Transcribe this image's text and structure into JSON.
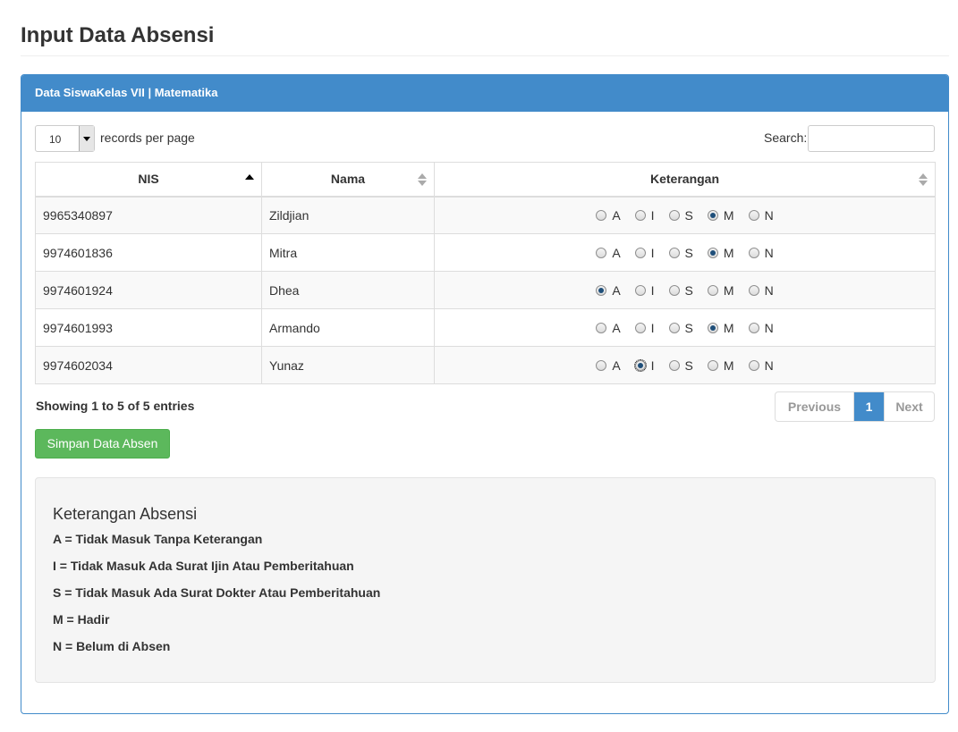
{
  "page": {
    "title": "Input Data Absensi"
  },
  "panel": {
    "heading": "Data SiswaKelas VII | Matematika"
  },
  "controls": {
    "length_value": "10",
    "length_label": "records per page",
    "search_label": "Search:",
    "search_value": ""
  },
  "table": {
    "headers": [
      "NIS",
      "Nama",
      "Keterangan"
    ],
    "rows": [
      {
        "nis": "9965340897",
        "nama": "Zildjian",
        "selected": "M"
      },
      {
        "nis": "9974601836",
        "nama": "Mitra",
        "selected": "M"
      },
      {
        "nis": "9974601924",
        "nama": "Dhea",
        "selected": "A"
      },
      {
        "nis": "9974601993",
        "nama": "Armando",
        "selected": "M"
      },
      {
        "nis": "9974602034",
        "nama": "Yunaz",
        "selected": "I"
      }
    ],
    "options": [
      "A",
      "I",
      "S",
      "M",
      "N"
    ]
  },
  "footer": {
    "info": "Showing 1 to 5 of 5 entries",
    "prev": "Previous",
    "page": "1",
    "next": "Next"
  },
  "save_button": "Simpan Data Absen",
  "legend": {
    "title": "Keterangan Absensi",
    "items": [
      "A = Tidak Masuk Tanpa Keterangan",
      "I = Tidak Masuk Ada Surat Ijin Atau Pemberitahuan",
      "S = Tidak Masuk Ada Surat Dokter Atau Pemberitahuan",
      "M = Hadir",
      "N = Belum di Absen"
    ]
  },
  "colors": {
    "primary": "#428bca",
    "success": "#5cb85c"
  }
}
